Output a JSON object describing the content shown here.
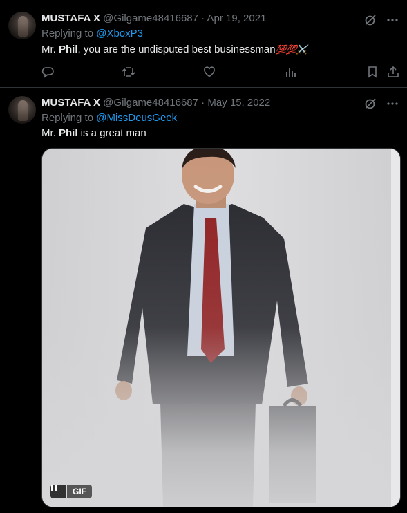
{
  "tweets": [
    {
      "name": "MUSTAFA X",
      "handle": "@Gilgame48416687",
      "sep": "·",
      "date": "Apr 19, 2021",
      "replying_prefix": "Replying to",
      "replying_to": "@XboxP3",
      "text_pre": "Mr. ",
      "text_bold": "Phil",
      "text_post": ", you are the undisputed best businessman",
      "emoji": "💯💯⚔️"
    },
    {
      "name": "MUSTAFA X",
      "handle": "@Gilgame48416687",
      "sep": "·",
      "date": "May 15, 2022",
      "replying_prefix": "Replying to",
      "replying_to": "@MissDeusGeek",
      "text_pre": "Mr. ",
      "text_bold": "Phil",
      "text_post": " is a great man",
      "media": {
        "type": "gif",
        "badge": "GIF"
      }
    }
  ],
  "colors": {
    "background": "#000000",
    "text": "#e7e9ea",
    "muted": "#71767b",
    "link": "#1d9bf0",
    "divider": "#2f3336"
  },
  "icons": [
    "grok-icon",
    "more-icon",
    "reply-icon",
    "retweet-icon",
    "like-icon",
    "views-icon",
    "bookmark-icon",
    "share-icon",
    "pause-icon"
  ]
}
